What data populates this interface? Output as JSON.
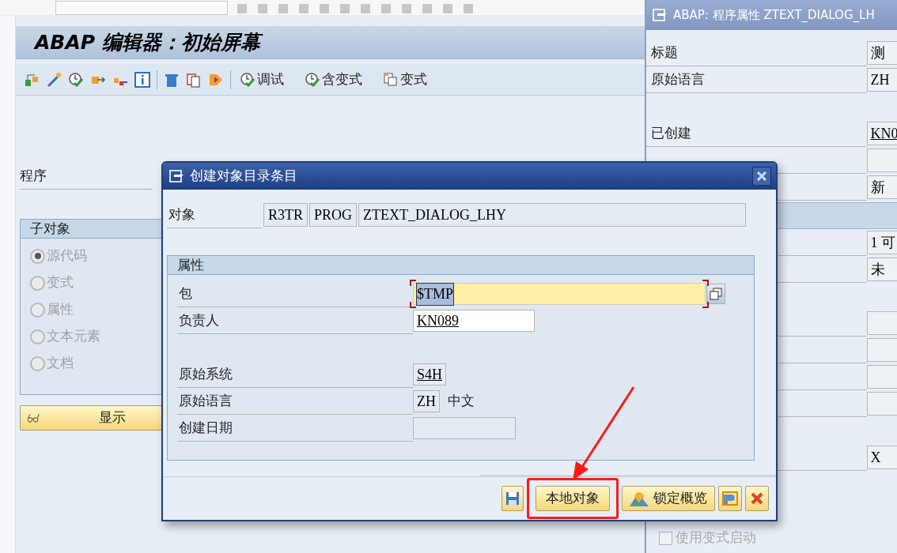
{
  "main": {
    "title": "ABAP 编辑器：初始屏幕",
    "toolbar_buttons": [
      {
        "label": "调试",
        "kind": "check"
      },
      {
        "label": "含变式",
        "kind": "check"
      },
      {
        "label": "变式",
        "kind": "variant"
      }
    ],
    "program_label": "程序",
    "subobjects": {
      "title": "子对象",
      "options": [
        {
          "label": "源代码",
          "selected": true,
          "disabled": true
        },
        {
          "label": "变式",
          "selected": false,
          "disabled": true
        },
        {
          "label": "属性",
          "selected": false,
          "disabled": true
        },
        {
          "label": "文本元素",
          "selected": false,
          "disabled": true
        },
        {
          "label": "文档",
          "selected": false,
          "disabled": true
        }
      ]
    },
    "display_button": "显示"
  },
  "attributes_window": {
    "title": "ABAP: 程序属性 ZTEXT_DIALOG_LH",
    "rows": [
      {
        "kind": "field",
        "label": "标题",
        "value": "测"
      },
      {
        "kind": "field",
        "label": "原始语言",
        "value": "ZH"
      },
      {
        "kind": "spacer"
      },
      {
        "kind": "field",
        "label": "已创建",
        "value": "KN0",
        "underlined": true
      },
      {
        "kind": "field"
      },
      {
        "kind": "field",
        "value": "新"
      },
      {
        "kind": "section"
      },
      {
        "kind": "field",
        "value": "1 可"
      },
      {
        "kind": "field",
        "value": "未"
      },
      {
        "kind": "spacer"
      },
      {
        "kind": "field"
      },
      {
        "kind": "field"
      },
      {
        "kind": "field"
      },
      {
        "kind": "field"
      },
      {
        "kind": "spacer"
      },
      {
        "kind": "field",
        "value": "X"
      },
      {
        "kind": "spacer"
      },
      {
        "kind": "spacer"
      },
      {
        "kind": "checkbox",
        "label": "使用变式启动",
        "checked": false
      }
    ]
  },
  "dialog": {
    "title": "创建对象目录条目",
    "object_label": "对象",
    "object_fields": [
      "R3TR",
      "PROG",
      "ZTEXT_DIALOG_LHY"
    ],
    "group_title": "属性",
    "rows": [
      {
        "kind": "field",
        "label": "包",
        "value": "$TMP",
        "editable": true,
        "required": true,
        "focused": true
      },
      {
        "kind": "field",
        "label": "负责人",
        "value": "KN089",
        "editable": true,
        "required": false,
        "underlined": true
      },
      {
        "kind": "spacer"
      },
      {
        "kind": "field",
        "label": "原始系统",
        "value": "S4H",
        "editable": false,
        "required": false,
        "underlined": true
      },
      {
        "kind": "field",
        "label": "原始语言",
        "value": "ZH",
        "editable": false,
        "required": false,
        "description": "中文"
      },
      {
        "kind": "field",
        "label": "创建日期",
        "editable": false,
        "required": false
      }
    ],
    "buttons": [
      {
        "kind": "save"
      },
      {
        "kind": "text",
        "label": "本地对象",
        "annotated": true
      },
      {
        "kind": "lock",
        "label": "锁定概览",
        "annotated": false
      },
      {
        "kind": "transport"
      },
      {
        "kind": "cancel"
      }
    ]
  }
}
